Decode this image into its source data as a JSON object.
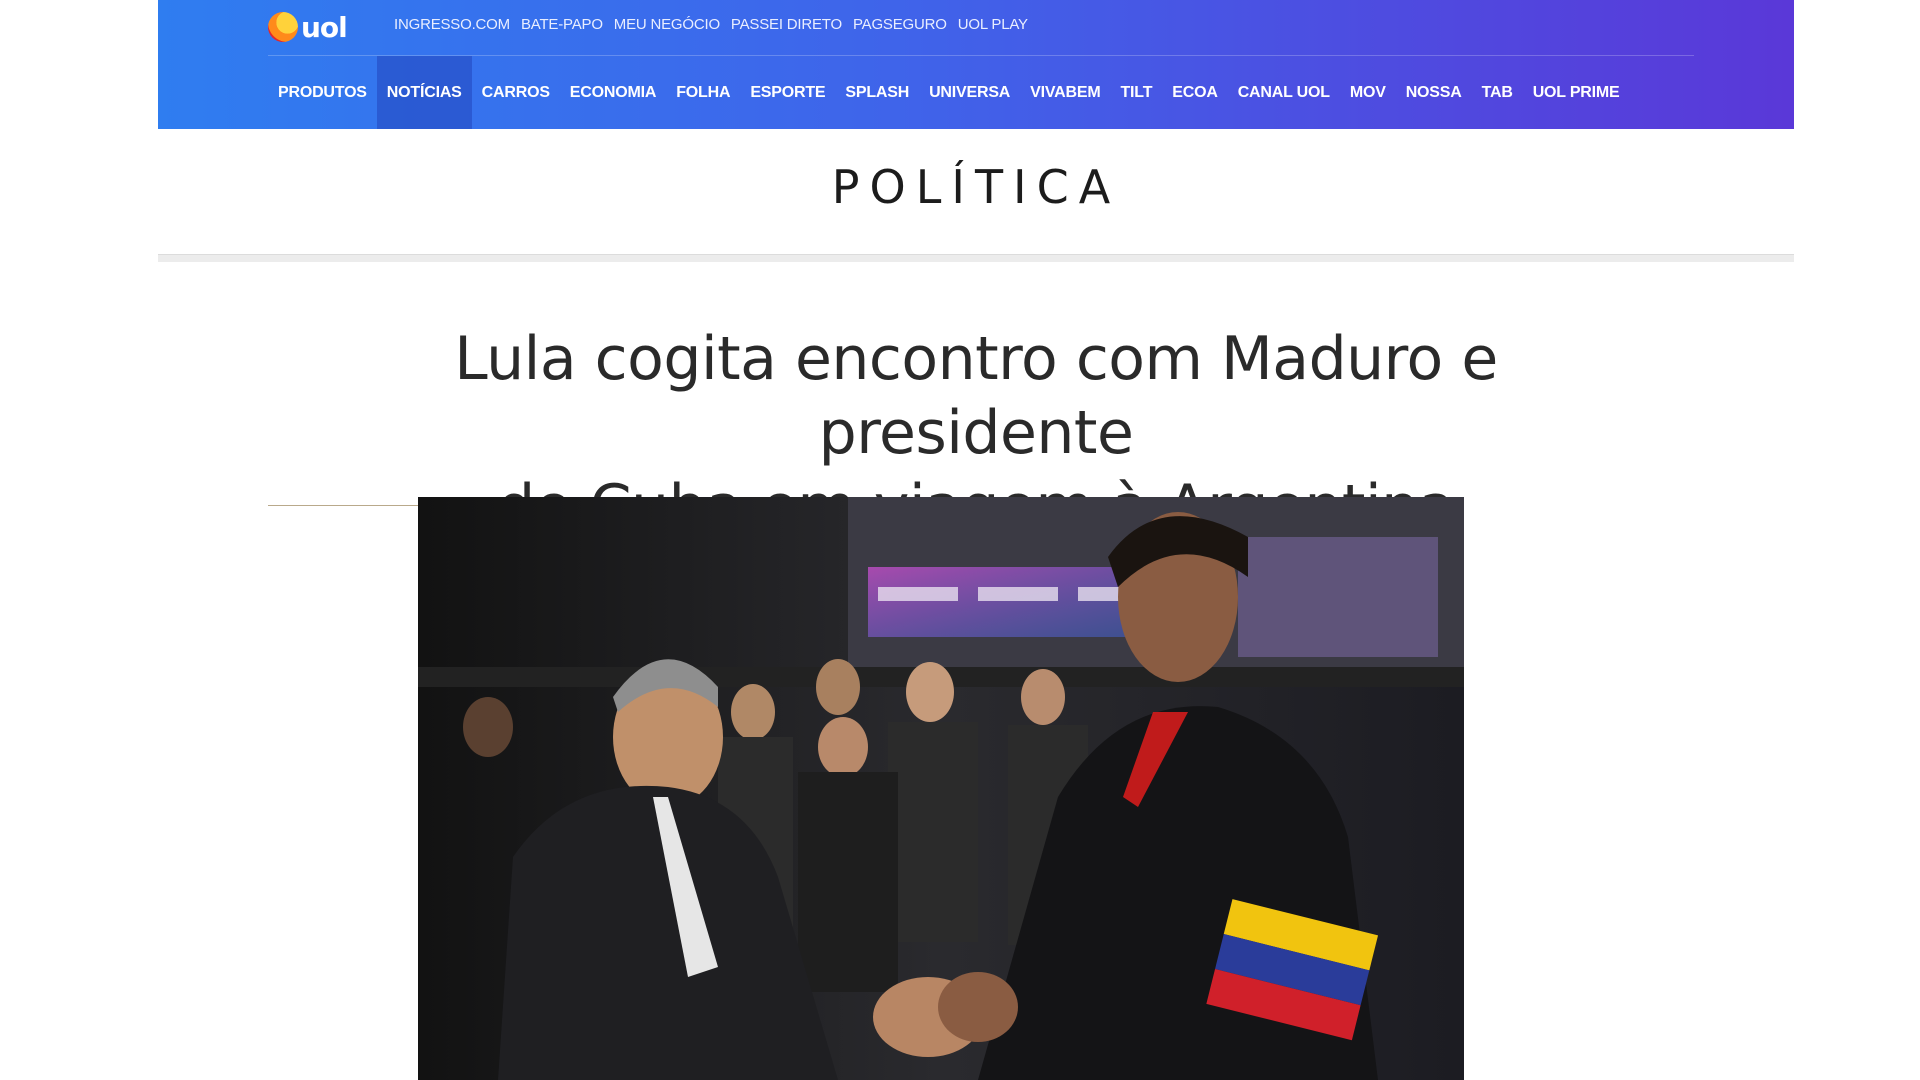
{
  "header": {
    "logo_text": "uol",
    "top_links": [
      "INGRESSO.COM",
      "BATE-PAPO",
      "MEU NEGÓCIO",
      "PASSEI DIRETO",
      "PAGSEGURO",
      "UOL PLAY"
    ],
    "nav": [
      {
        "label": "PRODUTOS",
        "active": false
      },
      {
        "label": "NOTÍCIAS",
        "active": true
      },
      {
        "label": "CARROS",
        "active": false
      },
      {
        "label": "ECONOMIA",
        "active": false
      },
      {
        "label": "FOLHA",
        "active": false
      },
      {
        "label": "ESPORTE",
        "active": false
      },
      {
        "label": "SPLASH",
        "active": false
      },
      {
        "label": "UNIVERSA",
        "active": false
      },
      {
        "label": "VIVABEM",
        "active": false
      },
      {
        "label": "TILT",
        "active": false
      },
      {
        "label": "ECOA",
        "active": false
      },
      {
        "label": "CANAL UOL",
        "active": false
      },
      {
        "label": "MOV",
        "active": false
      },
      {
        "label": "NOSSA",
        "active": false
      },
      {
        "label": "TAB",
        "active": false
      },
      {
        "label": "UOL PRIME",
        "active": false
      }
    ]
  },
  "section": {
    "title": "POLÍTICA"
  },
  "article": {
    "headline_line1": "Lula cogita encontro com Maduro e presidente",
    "headline_line2": "de Cuba em viagem à Argentina"
  },
  "colors": {
    "header_gradient_start": "#2f7df0",
    "header_gradient_end": "#5a38d8",
    "text": "#2a2a2a"
  }
}
